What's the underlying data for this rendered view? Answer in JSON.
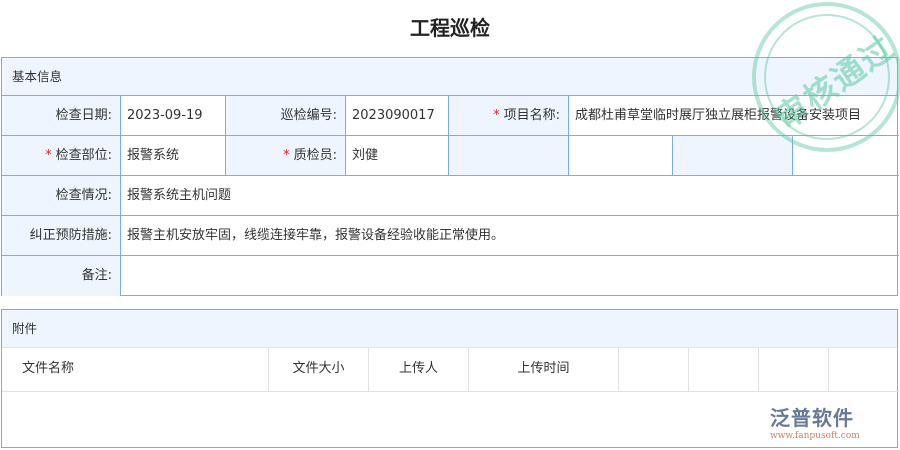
{
  "title": "工程巡检",
  "basic": {
    "section": "基本信息",
    "inspect_date_label": "检查日期:",
    "inspect_date": "2023-09-19",
    "patrol_no_label": "巡检编号:",
    "patrol_no": "2023090017",
    "project_label": "项目名称:",
    "project": "成都杜甫草堂临时展厅独立展柜报警设备安装项目",
    "part_label": "检查部位:",
    "part": "报警系统",
    "inspector_label": "质检员:",
    "inspector": "刘健",
    "situation_label": "检查情况:",
    "situation": "报警系统主机问题",
    "measures_label": "纠正预防措施:",
    "measures": "报警主机安放牢固，线缆连接牢靠，报警设备经验收能正常使用。",
    "remark_label": "备注:",
    "remark": "",
    "required_mark": "*"
  },
  "attach": {
    "section": "附件",
    "columns": [
      "文件名称",
      "文件大小",
      "上传人",
      "上传时间"
    ]
  },
  "stamp": "审核通过",
  "logo": {
    "name": "泛普软件",
    "url": "www.fanpusoft.com"
  }
}
